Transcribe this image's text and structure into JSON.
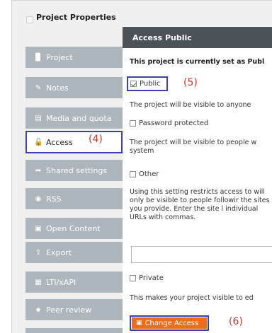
{
  "window": {
    "title": "Project Properties"
  },
  "sidebar": {
    "items": [
      {
        "label": "Project",
        "icon": "document-icon",
        "glyph": "▉",
        "active": false
      },
      {
        "label": "Notes",
        "icon": "edit-icon",
        "glyph": "✎",
        "active": false
      },
      {
        "label": "Media and quota",
        "icon": "media-icon",
        "glyph": "▤",
        "active": false
      },
      {
        "label": "Access",
        "icon": "unlock-icon",
        "glyph": "🔓",
        "active": true
      },
      {
        "label": "Shared settings",
        "icon": "share-icon",
        "glyph": "➦",
        "active": false
      },
      {
        "label": "RSS",
        "icon": "rss-icon",
        "glyph": "◉",
        "active": false
      },
      {
        "label": "Open Content",
        "icon": "open-content-icon",
        "glyph": "▣",
        "active": false
      },
      {
        "label": "Export",
        "icon": "export-icon",
        "glyph": "⇪",
        "active": false
      },
      {
        "label": "LTI/xAPI",
        "icon": "lti-icon",
        "glyph": "▦",
        "active": false
      },
      {
        "label": "Peer review",
        "icon": "chat-icon",
        "glyph": "●",
        "active": false
      }
    ]
  },
  "panel": {
    "title": "Access Public",
    "status_text": "This project is currently set as Publ",
    "public_label": "Public",
    "public_desc": "The project will be visible to anyone",
    "password_label": "Password protected",
    "password_desc": "The project will be visible to people w system",
    "other_label": "Other",
    "other_desc": "Using this setting restricts access to will only be visible to people followir the sites you provide. Enter the site l individual URLs with commas.",
    "url_input_value": "",
    "private_label": "Private",
    "private_desc": "This makes your project visible to ed",
    "change_button": "Change Access"
  },
  "callouts": {
    "access": "(4)",
    "public": "(5)",
    "change": "(6)"
  },
  "colors": {
    "accent_outline": "#3c3fb8",
    "callout": "#c0392b",
    "button": "#ee6d1b",
    "header": "#4b5258",
    "nav": "#aeb6bd"
  }
}
